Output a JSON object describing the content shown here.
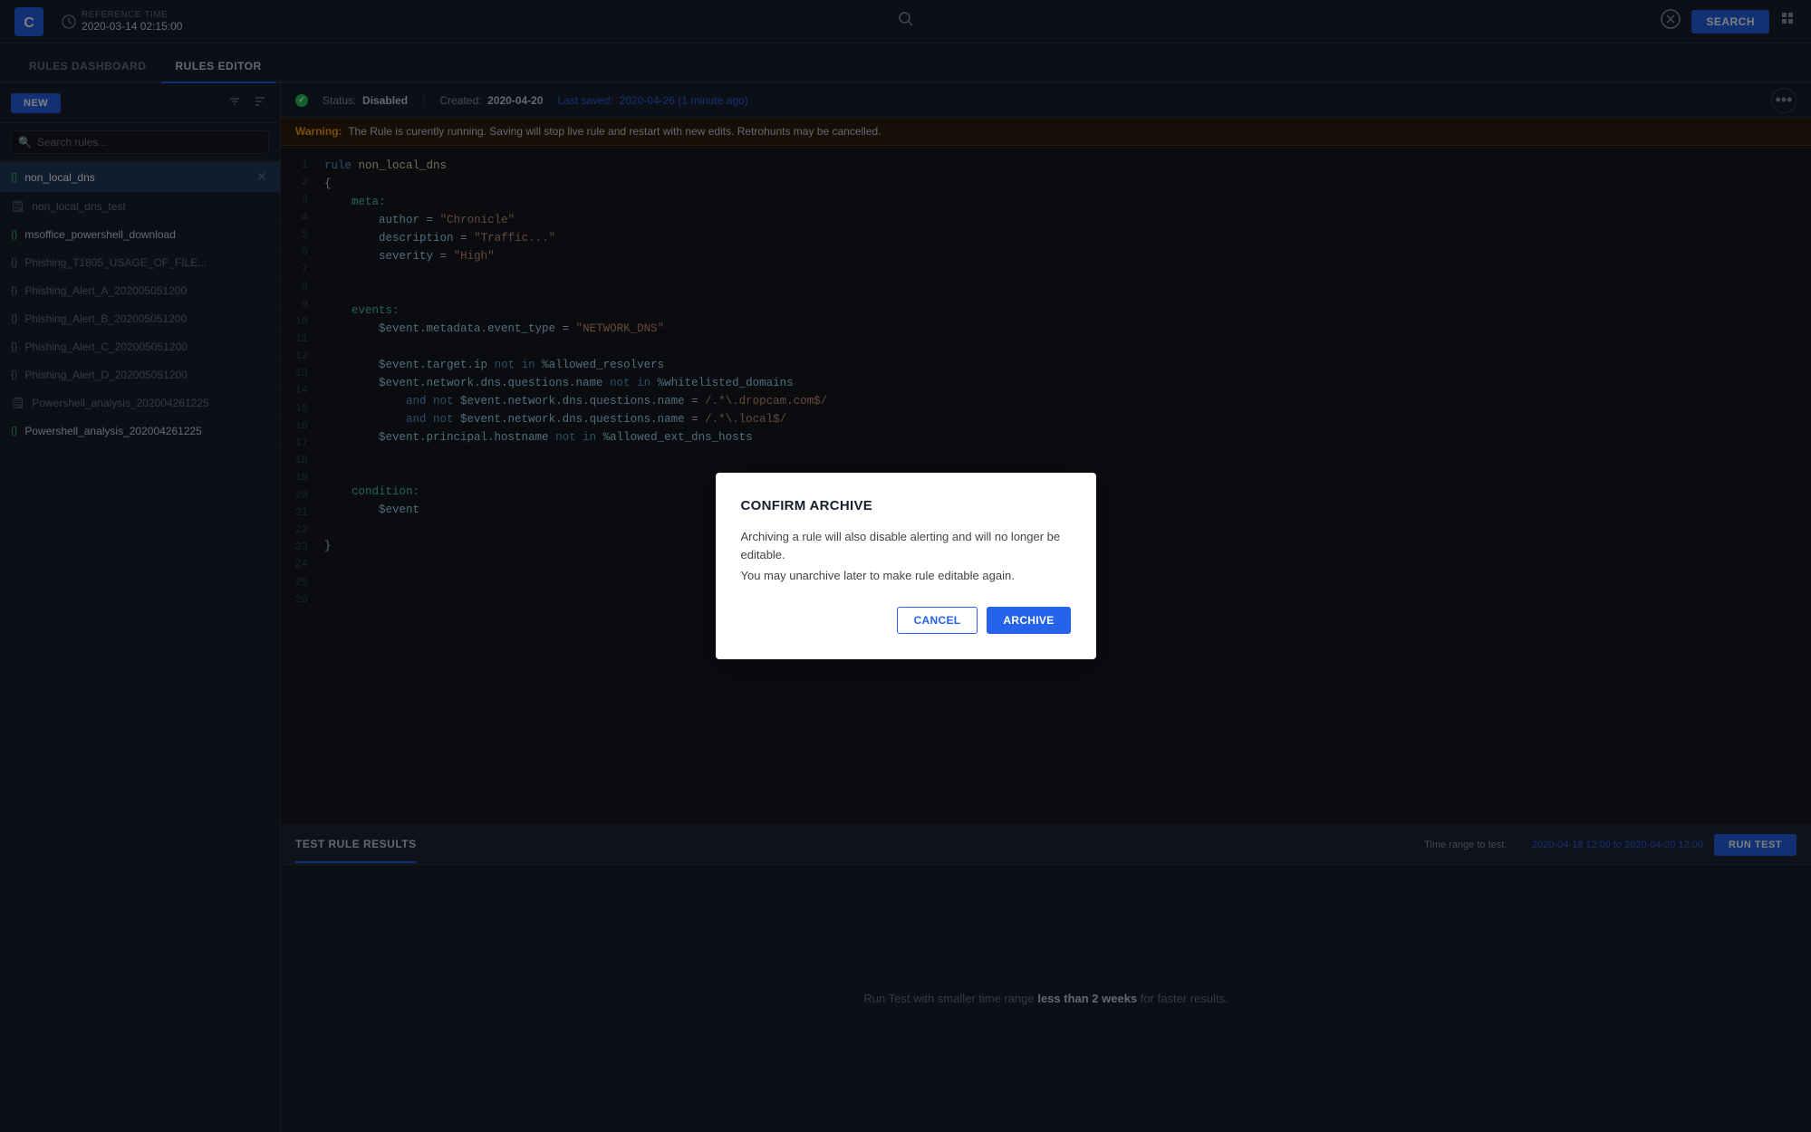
{
  "app": {
    "logo_text": "C"
  },
  "topnav": {
    "reference_time_label": "REFERENCE TIME",
    "reference_time_value": "2020-03-14  02:15:00",
    "search_label": "SEARCH"
  },
  "tabs": {
    "rules_dashboard": "RULES DASHBOARD",
    "rules_editor": "RULES EDITOR"
  },
  "sidebar": {
    "new_btn": "NEW",
    "search_placeholder": "Search rules...",
    "rules": [
      {
        "name": "non_local_dns",
        "type": "enabled",
        "active": true
      },
      {
        "name": "non_local_dns_test",
        "type": "disabled",
        "active": false
      },
      {
        "name": "msoffice_powershell_download",
        "type": "enabled",
        "active": false
      },
      {
        "name": "Phishing_T1805_USAGE_OF_FILE...",
        "type": "braces",
        "active": false
      },
      {
        "name": "Phishing_Alert_A_202005051200",
        "type": "braces",
        "active": false
      },
      {
        "name": "Phishing_Alert_B_202005051200",
        "type": "braces",
        "active": false
      },
      {
        "name": "Phishing_Alert_C_202005051200",
        "type": "braces",
        "active": false
      },
      {
        "name": "Phishing_Alert_D_202005051200",
        "type": "braces",
        "active": false
      },
      {
        "name": "Powershell_analysis_202004261225",
        "type": "disabled",
        "active": false
      },
      {
        "name": "Powershell_analysis_202004261225",
        "type": "braces",
        "active": false
      }
    ]
  },
  "statusbar": {
    "status_label": "Status:",
    "status_value": "Disabled",
    "created_label": "Created:",
    "created_value": "2020-04-20",
    "last_saved_label": "Last saved:",
    "last_saved_value": "2020-04-26 (1 minute ago)"
  },
  "warning": {
    "label": "Warning:",
    "message": "The Rule is curently running.  Saving will stop  live rule and restart with new edits.  Retrohunts may be cancelled."
  },
  "code": {
    "lines": [
      "rule non_local_dns",
      "{",
      "    meta:",
      "        author = \"Chronicle\"",
      "        description = \"Traffic...\"",
      "        severity = \"High\"",
      "",
      "",
      "    events:",
      "        $event.metadata.event_type = \"NETWORK_DNS\"",
      "",
      "        $event.target.ip not in %allowed_resolvers",
      "        $event.network.dns.questions.name not in %whitelisted_domains",
      "            and not $event.network.dns.questions.name = /.*\\.dropcam.com$/",
      "            and not $event.network.dns.questions.name = /.*\\.local$/",
      "        $event.principal.hostname not in %allowed_ext_dns_hosts",
      "",
      "",
      "    condition:",
      "        $event",
      "",
      "}",
      "",
      "",
      "",
      ""
    ]
  },
  "bottom_panel": {
    "title": "TEST RULE RESULTS",
    "time_range_label": "Time range to test:",
    "time_range_value": "2020-04-18 12:00 to 2020-04-20 12:00",
    "run_test_btn": "RUN TEST",
    "hint_text": "Run Test with smaller time range ",
    "hint_bold": "less than 2 weeks",
    "hint_suffix": " for faster results."
  },
  "modal": {
    "title": "CONFIRM ARCHIVE",
    "body_line1": "Archiving a rule will also disable alerting  and will no longer be editable.",
    "body_line2": "You may unarchive later to make rule editable again.",
    "cancel_btn": "CANCEL",
    "archive_btn": "ARCHIVE"
  }
}
